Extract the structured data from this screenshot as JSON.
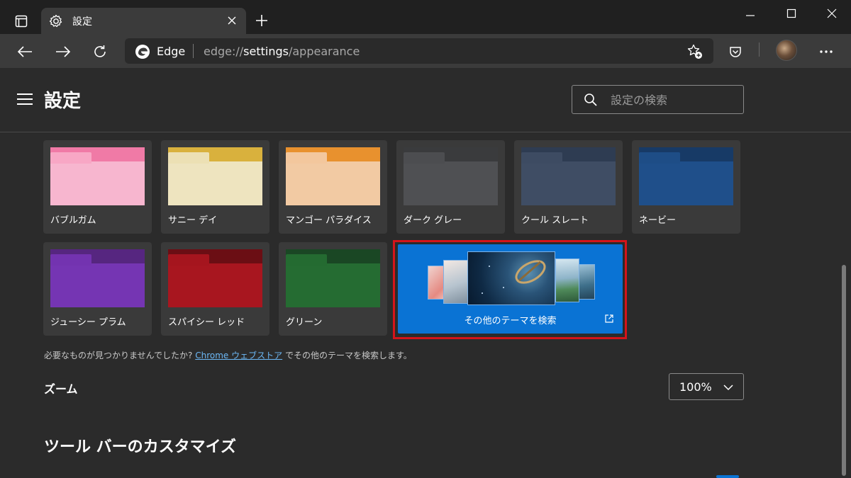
{
  "tab": {
    "title": "設定"
  },
  "address": {
    "site": "Edge",
    "url_prefix": "edge://",
    "url_host": "settings",
    "url_path": "/appearance"
  },
  "header": {
    "title": "設定",
    "search_placeholder": "設定の検索"
  },
  "themes": [
    {
      "name": "バブルガム",
      "back": "#f07aa6",
      "tab": "#f8a7c5",
      "front": "#f7b6cf"
    },
    {
      "name": "サニー デイ",
      "back": "#d9b13d",
      "tab": "#ece0b4",
      "front": "#eee4bf"
    },
    {
      "name": "マンゴー パラダイス",
      "back": "#e8912e",
      "tab": "#f3c79d",
      "front": "#f2caa3"
    },
    {
      "name": "ダーク グレー",
      "back": "#3a3b3d",
      "tab": "#4c4d50",
      "front": "#4f5053"
    },
    {
      "name": "クール スレート",
      "back": "#2e3c52",
      "tab": "#3d4b62",
      "front": "#3f4d64"
    },
    {
      "name": "ネービー",
      "back": "#173a66",
      "tab": "#1e4d86",
      "front": "#1f4f8a"
    },
    {
      "name": "ジューシー プラム",
      "back": "#562680",
      "tab": "#7333b0",
      "front": "#7535b3"
    },
    {
      "name": "スパイシー レッド",
      "back": "#6b0e14",
      "tab": "#a5151e",
      "front": "#a8161f"
    },
    {
      "name": "グリーン",
      "back": "#1a4724",
      "tab": "#246b31",
      "front": "#256c32"
    }
  ],
  "more_themes": {
    "label": "その他のテーマを検索"
  },
  "note": {
    "before": "必要なものが見つかりませんでしたか?",
    "link": "Chrome ウェブストア",
    "after": "でその他のテーマを検索します。"
  },
  "zoom": {
    "label": "ズーム",
    "value": "100%"
  },
  "toolbar_section": {
    "title": "ツール バーのカスタマイズ"
  }
}
